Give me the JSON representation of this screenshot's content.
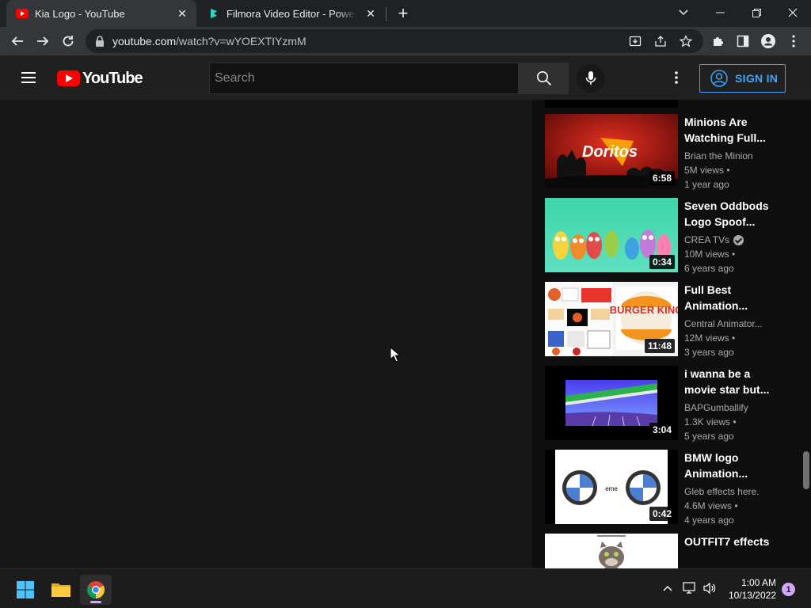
{
  "browser": {
    "tabs": [
      {
        "title": "Kia Logo - YouTube",
        "favicon": "youtube-icon",
        "active": true
      },
      {
        "title": "Filmora Video Editor - Powerful V",
        "favicon": "filmora-icon",
        "active": false
      }
    ],
    "url_host": "youtube.com",
    "url_path": "/watch?v=wYOEXTIYzmM"
  },
  "youtube": {
    "logo_text": "YouTube",
    "search_placeholder": "Search",
    "sign_in_label": "SIGN IN"
  },
  "recommendations": [
    {
      "title": "Minions Are Watching Full...",
      "channel": "Brian the Minion",
      "views": "5M views •",
      "age": "1 year ago",
      "duration": "6:58",
      "verified": false,
      "thumb": "doritos"
    },
    {
      "title": "Seven Oddbods Logo Spoof...",
      "channel": "CREA TVs",
      "views": "10M views •",
      "age": "6 years ago",
      "duration": "0:34",
      "verified": true,
      "thumb": "oddbods"
    },
    {
      "title": "Full Best Animation...",
      "channel": "Central Animator...",
      "views": "12M views •",
      "age": "3 years ago",
      "duration": "11:48",
      "verified": false,
      "thumb": "burgerking"
    },
    {
      "title": "i wanna be a movie star but...",
      "channel": "BAPGumballify",
      "views": "1.3K views •",
      "age": "5 years ago",
      "duration": "3:04",
      "verified": false,
      "thumb": "moviestar"
    },
    {
      "title": "BMW logo Animation...",
      "channel": "Gleb effects here.",
      "views": "4.6M views •",
      "age": "4 years ago",
      "duration": "0:42",
      "verified": false,
      "thumb": "bmw"
    },
    {
      "title": "OUTFIT7 effects",
      "channel": "",
      "views": "",
      "age": "",
      "duration": "",
      "verified": false,
      "thumb": "tom"
    }
  ],
  "bmw_thumb_text": "eme",
  "doritos_thumb_text": "Doritos",
  "burger_king_thumb_text": "BURGER KING",
  "taskbar": {
    "time": "1:00 AM",
    "date": "10/13/2022",
    "notification_count": "1"
  },
  "colors": {
    "accent_blue": "#3ea6ff",
    "youtube_red": "#ff0000",
    "chrome_dark": "#202124"
  }
}
